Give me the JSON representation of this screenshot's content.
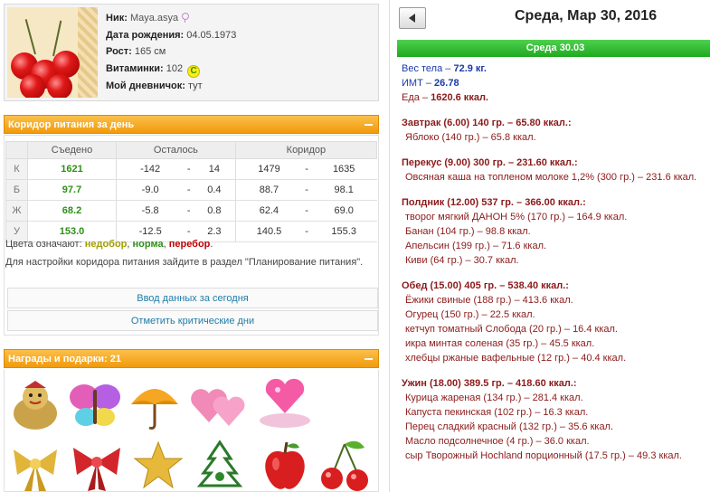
{
  "profile": {
    "nick_label": "Ник:",
    "nick": "Maya.asya",
    "birth_label": "Дата рождения:",
    "birth": "04.05.1973",
    "height_label": "Рост:",
    "height": "165 см",
    "vitamins_label": "Витаминки:",
    "vitamins": "102",
    "vitamins_badge": "C",
    "diary_label": "Мой дневничок:",
    "diary": "тут"
  },
  "corridor": {
    "title": "Коридор питания за день",
    "headers": [
      "Съедено",
      "Осталось",
      "Коридор"
    ],
    "rows": [
      {
        "label": "К",
        "eaten": "1621",
        "left_a": "-142",
        "left_b": "14",
        "corr_a": "1479",
        "corr_b": "1635"
      },
      {
        "label": "Б",
        "eaten": "97.7",
        "left_a": "-9.0",
        "left_b": "0.4",
        "corr_a": "88.7",
        "corr_b": "98.1"
      },
      {
        "label": "Ж",
        "eaten": "68.2",
        "left_a": "-5.8",
        "left_b": "0.8",
        "corr_a": "62.4",
        "corr_b": "69.0"
      },
      {
        "label": "У",
        "eaten": "153.0",
        "left_a": "-12.5",
        "left_b": "2.3",
        "corr_a": "140.5",
        "corr_b": "155.3"
      }
    ],
    "dash": "-",
    "legend_prefix": "Цвета означают:",
    "legend_nedobor": "недобор",
    "legend_norma": "норма",
    "legend_perebor": "перебор",
    "hint": "Для настройки коридора питания зайдите в раздел \"Планирование питания\".",
    "btn_today": "Ввод данных за сегодня",
    "btn_critical": "Отметить критические дни"
  },
  "gifts": {
    "title": "Награды и подарки: 21"
  },
  "day": {
    "title": "Среда, Мар 30, 2016",
    "bar": "Среда 30.03",
    "weight_label": "Вес тела –",
    "weight": "72.9 кг.",
    "bmi_label": "ИМТ –",
    "bmi": "26.78",
    "food_label": "Еда –",
    "food": "1620.6 ккал."
  },
  "meals": [
    {
      "title": "Завтрак (6.00) 140 гр. – 65.80 ккал.:",
      "items": [
        "Яблоко (140 гр.) – 65.8 ккал."
      ]
    },
    {
      "title": "Перекус (9.00) 300 гр. – 231.60 ккал.:",
      "items": [
        "Овсяная каша на топленом молоке 1,2% (300 гр.) – 231.6 ккал."
      ]
    },
    {
      "title": "Полдник (12.00) 537 гр. – 366.00 ккал.:",
      "items": [
        "творог мягкий ДАНОН 5% (170 гр.) – 164.9 ккал.",
        "Банан (104 гр.) – 98.8 ккал.",
        "Апельсин (199 гр.) – 71.6 ккал.",
        "Киви (64 гр.) – 30.7 ккал."
      ]
    },
    {
      "title": "Обед (15.00) 405 гр. – 538.40 ккал.:",
      "items": [
        "Ёжики свиные (188 гр.) – 413.6 ккал.",
        "Огурец (150 гр.) – 22.5 ккал.",
        "кетчуп томатный Слобода (20 гр.) – 16.4 ккал.",
        "икра минтая соленая (35 гр.) – 45.5 ккал.",
        "хлебцы ржаные вафельные (12 гр.) – 40.4 ккал."
      ]
    },
    {
      "title": "Ужин (18.00) 389.5 гр. – 418.60 ккал.:",
      "items": [
        "Курица жареная (134 гр.) – 281.4 ккал.",
        "Капуста пекинская (102 гр.) – 16.3 ккал.",
        "Перец сладкий красный (132 гр.) – 35.6 ккал.",
        "Масло подсолнечное (4 гр.) – 36.0 ккал.",
        "сыр Творожный Hochland порционный (17.5 гр.) – 49.3 ккал."
      ]
    }
  ],
  "colors": {
    "accent_orange": "#f29a0c",
    "green_bar": "#1fa81f",
    "meal_red": "#8b1a1a",
    "stat_blue": "#1a3ba8",
    "eaten_green": "#2f8f18"
  }
}
